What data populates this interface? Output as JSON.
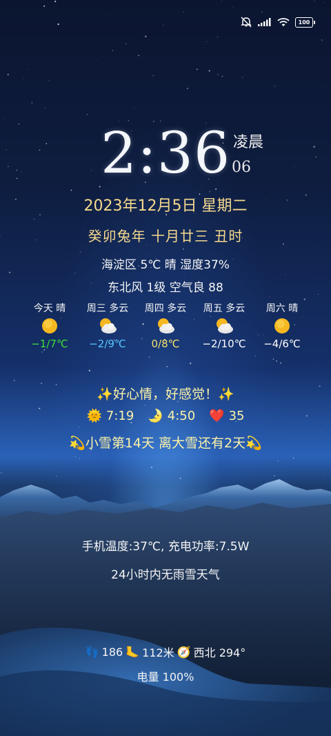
{
  "status_bar": {
    "battery": "100",
    "icons": [
      "mute-icon",
      "signal-icon",
      "wifi-icon",
      "battery-icon"
    ]
  },
  "clock": {
    "time": "2:36",
    "period": "凌晨",
    "seconds": "06"
  },
  "date": "2023年12月5日 星期二",
  "lunar": "癸卯兔年 十月廿三  丑时",
  "weather": {
    "line1": "海淀区 5℃ 晴 湿度37%",
    "line2": "东北风 1级 空气良 88"
  },
  "forecast": [
    {
      "label": "今天 晴",
      "icon": "sunny-icon",
      "temp": "−1/7℃",
      "color": "#3be03b"
    },
    {
      "label": "周三 多云",
      "icon": "cloudy-icon",
      "temp": "−2/9℃",
      "color": "#56c8ff"
    },
    {
      "label": "周四 多云",
      "icon": "cloudy-icon",
      "temp": "0/8℃",
      "color": "#f7e36a"
    },
    {
      "label": "周五 多云",
      "icon": "cloudy-icon",
      "temp": "−2/10℃",
      "color": "#ffffff"
    },
    {
      "label": "周六 晴",
      "icon": "sunny-icon",
      "temp": "−4/6℃",
      "color": "#ffffff"
    }
  ],
  "mood": "✨好心情，好感觉！✨",
  "sun_moon": {
    "sunrise": "7:19",
    "moonrise": "4:50",
    "heart": "35"
  },
  "snow": "💫小雪第14天  离大雪还有2天💫",
  "phone": "手机温度:37℃, 充电功率:7.5W",
  "rain": "24小时内无雨雪天气",
  "steps": {
    "count": "186",
    "distance": "112米",
    "direction": "西北 294°"
  },
  "power": "电量 100%"
}
